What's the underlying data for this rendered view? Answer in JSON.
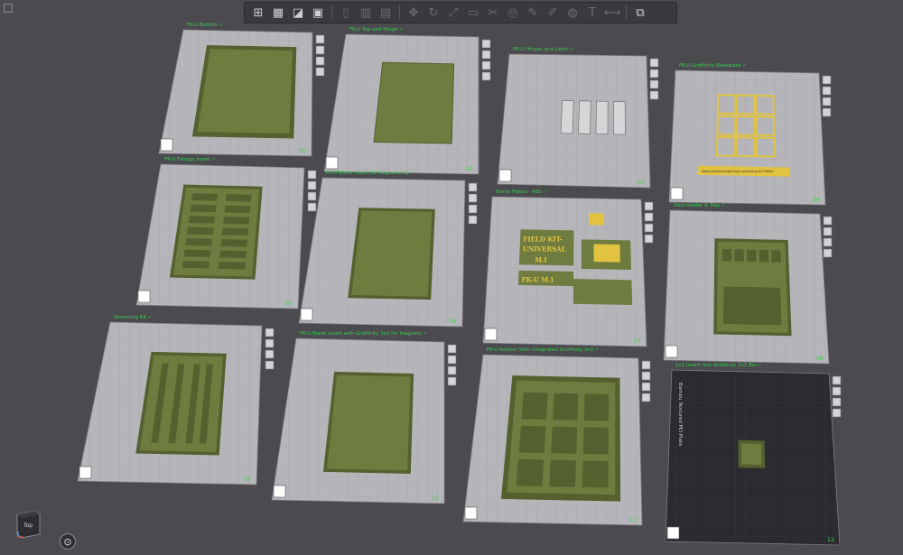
{
  "colors": {
    "background": "#4a4a4f",
    "plate": "#b6b6ba",
    "plate_grid": "#9c9ca1",
    "part_green": "#6f7c3f",
    "part_green_dark": "#55602f",
    "label_green": "#33d24a",
    "yellow_part": "#e1c341",
    "dark_plate": "#2b2b2f"
  },
  "toolbar": {
    "buttons": [
      {
        "name": "add-plate-icon",
        "glyph": "⊞",
        "enabled": true
      },
      {
        "name": "arrange-icon",
        "glyph": "▦",
        "enabled": true
      },
      {
        "name": "orient-icon",
        "glyph": "◪",
        "enabled": true
      },
      {
        "name": "plate-settings-icon",
        "glyph": "▣",
        "enabled": true
      },
      {
        "name": "split-objects-icon",
        "glyph": "▯",
        "enabled": false
      },
      {
        "name": "split-parts-icon",
        "glyph": "▥",
        "enabled": false
      },
      {
        "name": "layers-icon",
        "glyph": "▤",
        "enabled": false
      },
      {
        "name": "move-icon",
        "glyph": "✥",
        "enabled": false
      },
      {
        "name": "rotate-icon",
        "glyph": "↻",
        "enabled": false
      },
      {
        "name": "scale-icon",
        "glyph": "⤢",
        "enabled": false
      },
      {
        "name": "lay-on-face-icon",
        "glyph": "▭",
        "enabled": false
      },
      {
        "name": "cut-icon",
        "glyph": "✂",
        "enabled": false
      },
      {
        "name": "mesh-boolean-icon",
        "glyph": "◎",
        "enabled": false
      },
      {
        "name": "support-paint-icon",
        "glyph": "✎",
        "enabled": false
      },
      {
        "name": "seam-paint-icon",
        "glyph": "✐",
        "enabled": false
      },
      {
        "name": "color-paint-icon",
        "glyph": "◍",
        "enabled": false
      },
      {
        "name": "text-emboss-icon",
        "glyph": "T",
        "enabled": false
      },
      {
        "name": "measure-icon",
        "glyph": "⟷",
        "enabled": false
      },
      {
        "name": "assembly-icon",
        "glyph": "⧉",
        "enabled": true
      }
    ]
  },
  "plates": [
    {
      "label": "FK-U Bottom ✓",
      "number": "01",
      "part": "case-bottom"
    },
    {
      "label": "FK-U Top and Hinge ✓",
      "number": "02",
      "part": "case-top"
    },
    {
      "label": "FK-U Hinges and Latch ✓",
      "number": "03",
      "part": "hinges"
    },
    {
      "label": "FK-U Gridfinity Baseplate ✓",
      "number": "04",
      "part": "baseplate"
    },
    {
      "label": "FK-U Foliage Insert ✓",
      "number": "05",
      "part": "foliage"
    },
    {
      "label": "FK-U Blank Insert for Magnetizing ✓",
      "number": "06",
      "part": "blank"
    },
    {
      "label": "Name Plates - ABS ✓",
      "number": "07",
      "part": "nameplates"
    },
    {
      "label": "Dice Holder & Tray ✓",
      "number": "08",
      "part": "dice"
    },
    {
      "label": "Grooming Kit ✓",
      "number": "09",
      "part": "grooming"
    },
    {
      "label": "FK-U Blank Insert with Gridfinity 3x3 for magnets ✓",
      "number": "10",
      "part": "blank2"
    },
    {
      "label": "FK-U Bottom With Integrated Gridfinity 3x3 ✓",
      "number": "11",
      "part": "bottom-grid"
    },
    {
      "label": "1x1 Insert test Gridfinity 1x1 Bin ✓",
      "number": "12",
      "part": "bin"
    }
  ],
  "nameplate_texts": {
    "line1": "FIELD KIT-",
    "line2": "UNIVERSAL",
    "line3": "M.I",
    "small": "FK-U M.I"
  },
  "baseplate_url": "https://www.thingiverse.com/thing:4170626",
  "textured_plate_label": "Bambu Textured PEI Plate",
  "nav_cube_label": "Top"
}
